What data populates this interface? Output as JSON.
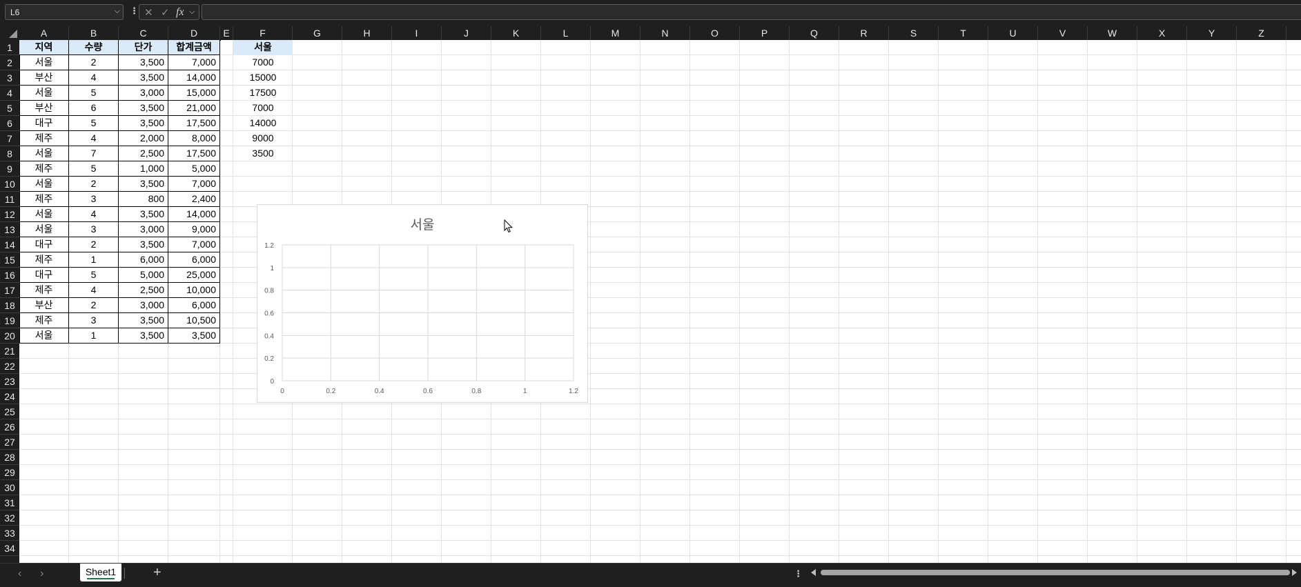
{
  "formula_bar": {
    "name_box": "L6",
    "name_box_arrow": "⌵",
    "options_glyph": "⋮",
    "cancel_glyph": "✕",
    "enter_glyph": "✓",
    "fx_label": "fx",
    "fx_arrow": "⌵",
    "formula": ""
  },
  "columns": [
    "A",
    "B",
    "C",
    "D",
    "E",
    "F",
    "G",
    "H",
    "I",
    "J",
    "K",
    "L",
    "M",
    "N",
    "O",
    "P",
    "Q",
    "R",
    "S",
    "T",
    "U",
    "V",
    "W",
    "X",
    "Y",
    "Z"
  ],
  "rows": [
    "1",
    "2",
    "3",
    "4",
    "5",
    "6",
    "7",
    "8",
    "9",
    "10",
    "11",
    "12",
    "13",
    "14",
    "15",
    "16",
    "17",
    "18",
    "19",
    "20",
    "21",
    "22",
    "23",
    "24",
    "25",
    "26",
    "27",
    "28",
    "29",
    "30",
    "31",
    "32",
    "33",
    "34"
  ],
  "table": {
    "headers": [
      "지역",
      "수량",
      "단가",
      "합계금액"
    ],
    "rows": [
      [
        "서울",
        "2",
        "3,500",
        "7,000"
      ],
      [
        "부산",
        "4",
        "3,500",
        "14,000"
      ],
      [
        "서울",
        "5",
        "3,000",
        "15,000"
      ],
      [
        "부산",
        "6",
        "3,500",
        "21,000"
      ],
      [
        "대구",
        "5",
        "3,500",
        "17,500"
      ],
      [
        "제주",
        "4",
        "2,000",
        "8,000"
      ],
      [
        "서울",
        "7",
        "2,500",
        "17,500"
      ],
      [
        "제주",
        "5",
        "1,000",
        "5,000"
      ],
      [
        "서울",
        "2",
        "3,500",
        "7,000"
      ],
      [
        "제주",
        "3",
        "800",
        "2,400"
      ],
      [
        "서울",
        "4",
        "3,500",
        "14,000"
      ],
      [
        "서울",
        "3",
        "3,000",
        "9,000"
      ],
      [
        "대구",
        "2",
        "3,500",
        "7,000"
      ],
      [
        "제주",
        "1",
        "6,000",
        "6,000"
      ],
      [
        "대구",
        "5",
        "5,000",
        "25,000"
      ],
      [
        "제주",
        "4",
        "2,500",
        "10,000"
      ],
      [
        "부산",
        "2",
        "3,000",
        "6,000"
      ],
      [
        "제주",
        "3",
        "3,500",
        "10,500"
      ],
      [
        "서울",
        "1",
        "3,500",
        "3,500"
      ]
    ]
  },
  "side_list": {
    "header": "서울",
    "values": [
      "7000",
      "15000",
      "17500",
      "7000",
      "14000",
      "9000",
      "3500"
    ]
  },
  "chart_data": {
    "type": "scatter",
    "title": "서울",
    "series": [],
    "xlim": [
      0,
      1.2
    ],
    "ylim": [
      0,
      1.2
    ],
    "x_ticks": [
      "0",
      "0.2",
      "0.4",
      "0.6",
      "0.8",
      "1",
      "1.2"
    ],
    "y_ticks": [
      "0",
      "0.2",
      "0.4",
      "0.6",
      "0.8",
      "1",
      "1.2"
    ],
    "grid": true
  },
  "tabs": {
    "prev": "‹",
    "next": "›",
    "sheets": [
      "Sheet1"
    ],
    "add": "+",
    "scroll_options": "⋮"
  },
  "colors": {
    "header_fill": "#dbeaf8",
    "active_tab_underline": "#107c41",
    "app_chrome": "#1f1f1f"
  }
}
